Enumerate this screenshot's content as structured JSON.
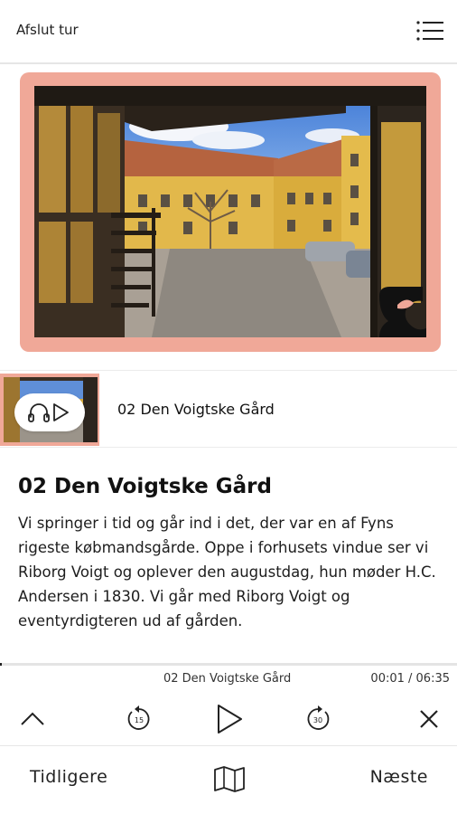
{
  "header": {
    "exit_label": "Afslut tur",
    "menu_icon": "list-menu-icon"
  },
  "hero": {
    "frame_color": "#f0a898",
    "logo_icon": "museum-logo-icon"
  },
  "track_item": {
    "title": "02 Den Voigtske Gård",
    "play_icon": "headphones-play-icon"
  },
  "content": {
    "heading": "02 Den Voigtske Gård",
    "body": "Vi springer i tid og går ind i det, der var en af Fyns rigeste købmandsgårde. Oppe i forhusets vindue ser vi Riborg Voigt og oplever den augustdag, hun møder H.C. Andersen i 1830. Vi går med Riborg Voigt og eventyrdigteren ud af gården."
  },
  "player": {
    "now_playing": "02 Den Voigtske Gård",
    "time": "00:01 / 06:35",
    "progress": 0.003,
    "rewind_seconds": "15",
    "forward_seconds": "30"
  },
  "footer_nav": {
    "previous_label": "Tidligere",
    "next_label": "Næste",
    "map_icon": "map-icon"
  }
}
